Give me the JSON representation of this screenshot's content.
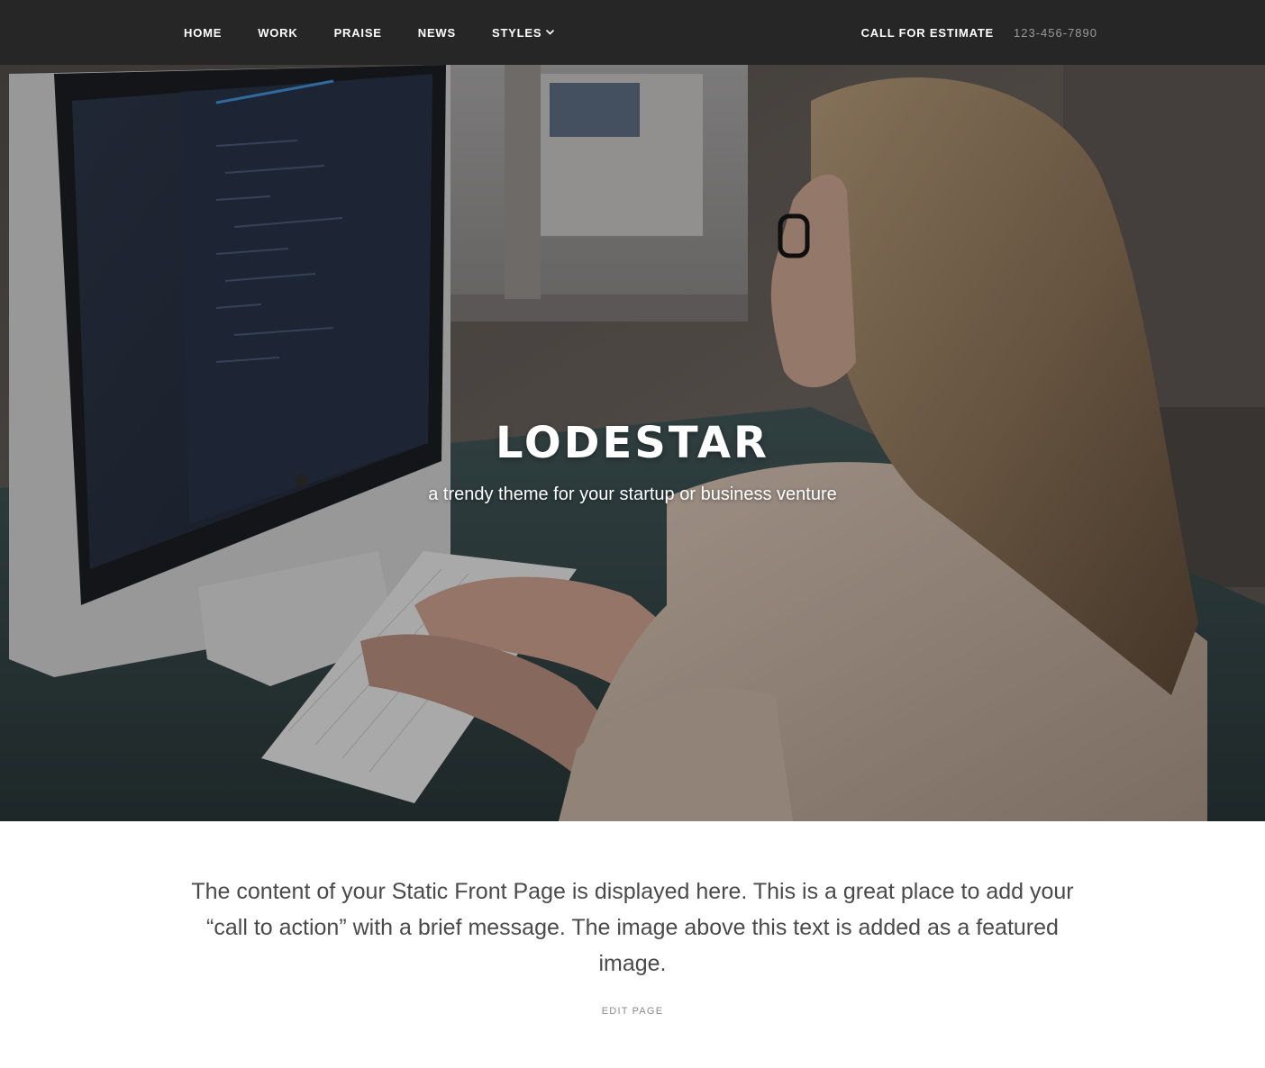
{
  "nav": {
    "items": [
      {
        "label": "HOME"
      },
      {
        "label": "WORK"
      },
      {
        "label": "PRAISE"
      },
      {
        "label": "NEWS"
      },
      {
        "label": "STYLES",
        "has_dropdown": true
      }
    ],
    "cta_label": "CALL FOR ESTIMATE",
    "phone": "123-456-7890"
  },
  "hero": {
    "title": "LODESTAR",
    "subtitle": "a trendy theme for your startup or business venture",
    "image_subject": "woman-typing-at-computer-photo"
  },
  "content": {
    "intro": "The content of your Static Front Page is displayed here. This is a great place to add your “call to action” with a brief message. The image above this text is added as a featured image.",
    "edit_link": "EDIT PAGE"
  },
  "colors": {
    "navbar_bg": "#262626",
    "nav_text": "#ffffff",
    "phone_text": "#9a9a9a",
    "body_text": "#4a4a4a",
    "page_bg": "#ffffff"
  }
}
